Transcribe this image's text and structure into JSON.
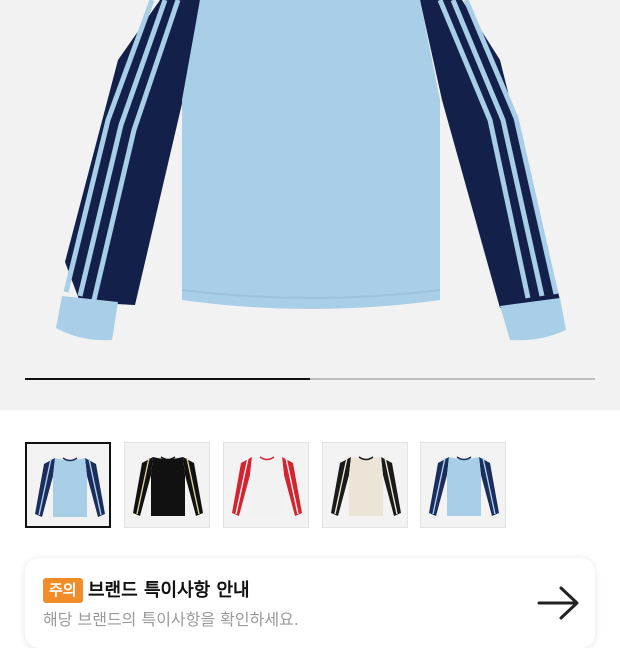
{
  "product_image": {
    "name": "long-sleeve-shirt-light-blue",
    "colors": {
      "body": "#a9cfe8",
      "sleeve": "#13204a",
      "stripe": "#a9cfe8",
      "cuff": "#a9cfe8",
      "background": "#f2f2f2"
    }
  },
  "gallery": {
    "progress": 0.5,
    "selected_index": 0,
    "thumbnails": [
      {
        "name": "thumbnail-light-blue",
        "body": "#a9cfe8",
        "sleeve": "#1b2d5c",
        "stripe": "#a9cfe8"
      },
      {
        "name": "thumbnail-black",
        "body": "#111111",
        "sleeve": "#111111",
        "stripe": "#d8cfa0"
      },
      {
        "name": "thumbnail-white-red",
        "body": "#f2f2f2",
        "sleeve": "#d32430",
        "stripe": "#f2f2f2"
      },
      {
        "name": "thumbnail-cream-black",
        "body": "#ece4d6",
        "sleeve": "#1a1a1a",
        "stripe": "#ece4d6"
      },
      {
        "name": "thumbnail-blue-navy",
        "body": "#a9cfe8",
        "sleeve": "#1b2d5c",
        "stripe": "#a9cfe8"
      }
    ]
  },
  "notice": {
    "badge": "주의",
    "title": "브랜드 특이사항 안내",
    "subtitle": "해당 브랜드의 특이사항을 확인하세요.",
    "badge_color": "#f28c28",
    "arrow_icon": "arrow-right-icon"
  }
}
